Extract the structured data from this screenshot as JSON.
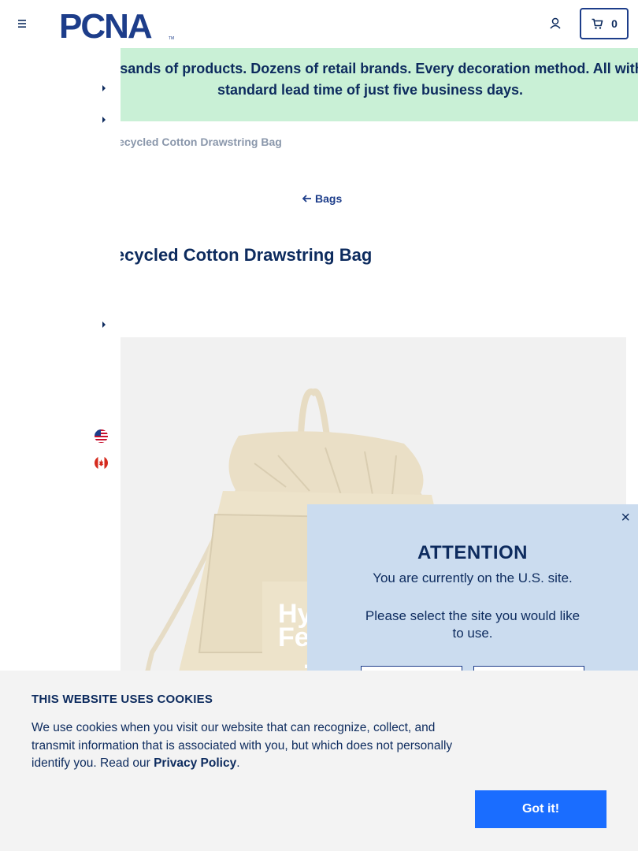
{
  "header": {
    "logo_text": "PCNA",
    "logo_tm": "TM",
    "cart_count": "0",
    "icons": {
      "menu": "hamburger-menu-icon",
      "account": "user-account-icon",
      "cart": "shopping-cart-icon"
    }
  },
  "banner": {
    "text": "Thousands of products. Dozens of retail brands. Every decoration method. All with a standard lead time of just five business days."
  },
  "breadcrumb": {
    "current": "Recycled Cotton Drawstring Bag"
  },
  "back_link": {
    "label": "Bags",
    "icon": "arrow-left-icon"
  },
  "product": {
    "title": "Recycled Cotton Drawstring Bag",
    "image_print": [
      "Hyd",
      "Feel",
      "."
    ]
  },
  "site_modal": {
    "close": "×",
    "title": "ATTENTION",
    "message": "You are currently on the U.S. site.",
    "prompt": "Please select the site you would like to use."
  },
  "cookie": {
    "title": "THIS WEBSITE USES COOKIES",
    "body": "We use cookies when you visit our website that can recognize, collect, and transmit information that is associated with you, but which does not personally identify you. Read our ",
    "link": "Privacy Policy",
    "end": ".",
    "button": "Got it!"
  },
  "colors": {
    "navy": "#0d2b5e",
    "brand_blue": "#1d3d8a",
    "banner_bg": "#c9f0d6",
    "modal_bg": "#cbdcef",
    "cookie_button": "#1a6dff"
  }
}
